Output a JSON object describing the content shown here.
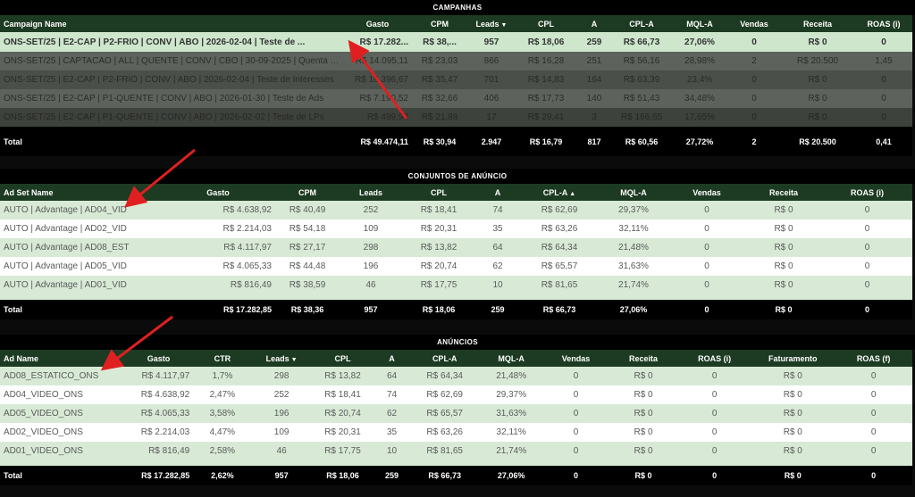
{
  "campanhas": {
    "title": "CAMPANHAS",
    "columns": [
      "Campaign Name",
      "Gasto",
      "CPM",
      "Leads",
      "CPL",
      "A",
      "CPL-A",
      "MQL-A",
      "Vendas",
      "Receita",
      "ROAS (i)"
    ],
    "sorted_column": "Leads",
    "sort_direction": "desc",
    "rows": [
      [
        "ONS-SET/25 | E2-CAP | P2-FRIO | CONV | ABO | 2026-02-04 | Teste de ...",
        "R$ 17.282...",
        "R$ 38,...",
        "957",
        "R$ 18,06",
        "259",
        "R$ 66,73",
        "27,06%",
        "0",
        "R$ 0",
        "0"
      ],
      [
        "ONS-SET/25 | CAPTACAO | ALL | QUENTE | CONV | CBO | 30-09-2025 | Quenta G...",
        "R$ 14.095,11",
        "R$ 23,03",
        "866",
        "R$ 16,28",
        "251",
        "R$ 56,16",
        "28,98%",
        "2",
        "R$ 20.500",
        "1,45"
      ],
      [
        "ONS-SET/25 | E2-CAP | P2-FRIO | CONV | ABO | 2026-02-04 | Teste de Interesses",
        "R$ 18.396,67",
        "R$ 35,47",
        "701",
        "R$ 14,83",
        "164",
        "R$ 63,39",
        "23,4%",
        "0",
        "R$ 0",
        "0"
      ],
      [
        "ONS-SET/25 | E2-CAP | P1-QUENTE | CONV | ABO | 2026-01-30 | Teste de Ads",
        "R$ 7.190,52",
        "R$ 32,66",
        "406",
        "R$ 17,73",
        "140",
        "R$ 51,43",
        "34,48%",
        "0",
        "R$ 0",
        "0"
      ],
      [
        "ONS-SET/25 | E2-CAP | P1-QUENTE | CONV | ABO | 2026-02-02 | Teste de LPs",
        "R$ 499,90",
        "R$ 21,88",
        "17",
        "R$ 29,41",
        "3",
        "R$ 166,65",
        "17,65%",
        "0",
        "R$ 0",
        "0"
      ]
    ],
    "total": [
      "Total",
      "R$ 49.474,11",
      "R$ 30,94",
      "2.947",
      "R$ 16,79",
      "817",
      "R$ 60,56",
      "27,72%",
      "2",
      "R$ 20.500",
      "0,41"
    ]
  },
  "conjuntos": {
    "title": "CONJUNTOS DE ANÚNCIO",
    "columns": [
      "Ad Set Name",
      "Gasto",
      "CPM",
      "Leads",
      "CPL",
      "A",
      "CPL-A",
      "MQL-A",
      "Vendas",
      "Receita",
      "ROAS (i)"
    ],
    "sorted_column": "CPL-A",
    "sort_direction": "asc",
    "rows": [
      [
        "AUTO | Advantage | AD04_VID",
        "R$ 4.638,92",
        "R$ 40,49",
        "252",
        "R$ 18,41",
        "74",
        "R$ 62,69",
        "29,37%",
        "0",
        "R$ 0",
        "0"
      ],
      [
        "AUTO | Advantage | AD02_VID",
        "R$ 2.214,03",
        "R$ 54,18",
        "109",
        "R$ 20,31",
        "35",
        "R$ 63,26",
        "32,11%",
        "0",
        "R$ 0",
        "0"
      ],
      [
        "AUTO | Advantage | AD08_EST",
        "R$ 4.117,97",
        "R$ 27,17",
        "298",
        "R$ 13,82",
        "64",
        "R$ 64,34",
        "21,48%",
        "0",
        "R$ 0",
        "0"
      ],
      [
        "AUTO | Advantage | AD05_VID",
        "R$ 4.065,33",
        "R$ 44,48",
        "196",
        "R$ 20,74",
        "62",
        "R$ 65,57",
        "31,63%",
        "0",
        "R$ 0",
        "0"
      ],
      [
        "AUTO | Advantage | AD01_VID",
        "R$ 816,49",
        "R$ 38,59",
        "46",
        "R$ 17,75",
        "10",
        "R$ 81,65",
        "21,74%",
        "0",
        "R$ 0",
        "0"
      ]
    ],
    "total": [
      "Total",
      "R$ 17.282,85",
      "R$ 38,36",
      "957",
      "R$ 18,06",
      "259",
      "R$ 66,73",
      "27,06%",
      "0",
      "R$ 0",
      "0"
    ]
  },
  "anuncios": {
    "title": "ANÚNCIOS",
    "columns": [
      "Ad Name",
      "Gasto",
      "CTR",
      "Leads",
      "CPL",
      "A",
      "CPL-A",
      "MQL-A",
      "Vendas",
      "Receita",
      "ROAS (i)",
      "Faturamento",
      "ROAS (f)"
    ],
    "sorted_column": "Leads",
    "sort_direction": "desc",
    "rows": [
      [
        "AD08_ESTATICO_ONS",
        "R$ 4.117,97",
        "1,7%",
        "298",
        "R$ 13,82",
        "64",
        "R$ 64,34",
        "21,48%",
        "0",
        "R$ 0",
        "0",
        "R$ 0",
        "0"
      ],
      [
        "AD04_VIDEO_ONS",
        "R$ 4.638,92",
        "2,47%",
        "252",
        "R$ 18,41",
        "74",
        "R$ 62,69",
        "29,37%",
        "0",
        "R$ 0",
        "0",
        "R$ 0",
        "0"
      ],
      [
        "AD05_VIDEO_ONS",
        "R$ 4.065,33",
        "3,58%",
        "196",
        "R$ 20,74",
        "62",
        "R$ 65,57",
        "31,63%",
        "0",
        "R$ 0",
        "0",
        "R$ 0",
        "0"
      ],
      [
        "AD02_VIDEO_ONS",
        "R$ 2.214,03",
        "4,47%",
        "109",
        "R$ 20,31",
        "35",
        "R$ 63,26",
        "32,11%",
        "0",
        "R$ 0",
        "0",
        "R$ 0",
        "0"
      ],
      [
        "AD01_VIDEO_ONS",
        "R$ 816,49",
        "2,58%",
        "46",
        "R$ 17,75",
        "10",
        "R$ 81,65",
        "21,74%",
        "0",
        "R$ 0",
        "0",
        "R$ 0",
        "0"
      ]
    ],
    "total": [
      "Total",
      "R$ 17.282,85",
      "2,62%",
      "957",
      "R$ 18,06",
      "259",
      "R$ 66,73",
      "27,06%",
      "0",
      "R$ 0",
      "0",
      "R$ 0",
      "0"
    ]
  },
  "colors": {
    "header_bg": "#1d3b23",
    "highlight_row": "#cde6cc",
    "zebra_green": "#d8ead6",
    "annotation_arrow": "#e02020"
  }
}
